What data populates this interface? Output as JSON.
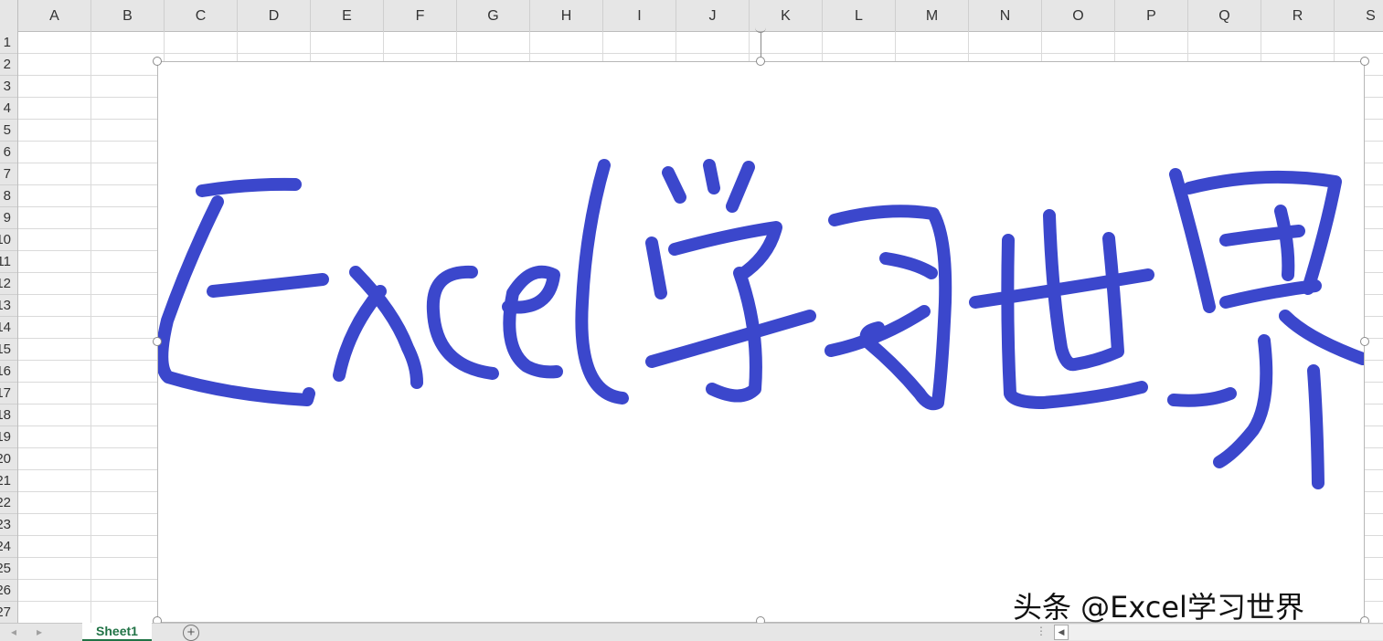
{
  "columns": [
    "A",
    "B",
    "C",
    "D",
    "E",
    "F",
    "G",
    "H",
    "I",
    "J",
    "K",
    "L",
    "M",
    "N",
    "O",
    "P",
    "Q",
    "R",
    "S"
  ],
  "rows": [
    "1",
    "2",
    "3",
    "4",
    "5",
    "6",
    "7",
    "8",
    "9",
    "10",
    "11",
    "12",
    "13",
    "14",
    "15",
    "16",
    "17",
    "18",
    "19",
    "20",
    "21",
    "22",
    "23",
    "24",
    "25",
    "26",
    "27"
  ],
  "sheet_tab": "Sheet1",
  "add_sheet_symbol": "+",
  "watermark": "头条 @Excel学习世界",
  "ink": {
    "color": "#3b47cc",
    "drawn_text": "Excel学习世界"
  },
  "icons": {
    "add_sheet": "plus-circle-icon",
    "scroll_left": "chevron-left-icon",
    "tab_nav_prev": "chevron-left-icon",
    "tab_nav_next": "chevron-right-icon"
  }
}
